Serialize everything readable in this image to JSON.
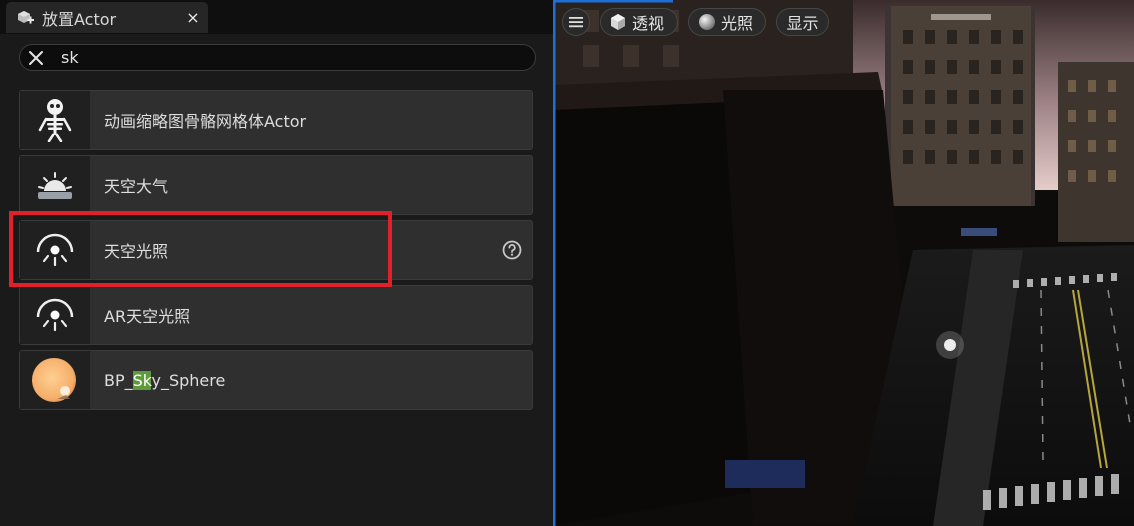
{
  "panel": {
    "tab": {
      "icon": "place-actors-icon",
      "title": "放置Actor",
      "close_icon": "close-icon",
      "close_label": "×"
    },
    "search": {
      "value": "sk",
      "placeholder": "",
      "clear_icon": "clear-x-icon"
    },
    "items": [
      {
        "label": "动画缩略图骨骼网格体Actor",
        "icon": "skeleton-icon"
      },
      {
        "label": "天空大气",
        "icon": "sky-atmosphere-icon"
      },
      {
        "label": "天空光照",
        "icon": "sky-light-icon",
        "help_icon": "help-question-icon",
        "highlighted": true
      },
      {
        "label": "AR天空光照",
        "icon": "sky-light-icon"
      },
      {
        "label_prefix": "BP_",
        "label_match": "Sk",
        "label_suffix": "y_Sphere",
        "icon": "sky-sphere-icon"
      }
    ]
  },
  "viewport": {
    "menu_icon": "hamburger-menu-icon",
    "perspective": {
      "icon": "cube-icon",
      "label": "透视"
    },
    "lighting": {
      "icon": "sphere-icon",
      "label": "光照"
    },
    "show": {
      "label": "显示"
    }
  },
  "colors": {
    "panel_bg": "#1a1a1a",
    "item_bg": "#2f2f2f",
    "search_match": "#5f9a3c",
    "annotation_red": "#e0202a",
    "viewport_border": "#1f6fd6"
  }
}
